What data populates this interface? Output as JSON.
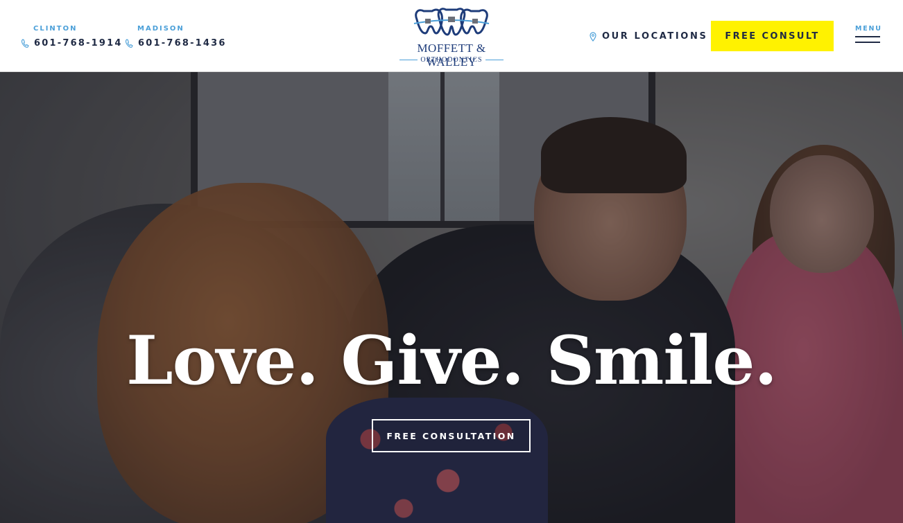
{
  "header": {
    "phones": [
      {
        "city": "CLINTON",
        "number": "601-768-1914"
      },
      {
        "city": "MADISON",
        "number": "601-768-1436"
      }
    ],
    "logo": {
      "name": "MOFFETT & WALLEY",
      "subtitle": "ORTHODONTICS"
    },
    "locations_label": "OUR LOCATIONS",
    "consult_button": "FREE CONSULT",
    "menu_label": "MENU"
  },
  "hero": {
    "headline": "Love. Give. Smile.",
    "cta_button": "FREE CONSULTATION"
  },
  "colors": {
    "accent_blue": "#4a9fd8",
    "navy": "#1f2a44",
    "logo_navy": "#1e3c7a",
    "cta_yellow": "#fff200"
  },
  "icons": [
    "phone-icon",
    "map-pin-icon",
    "hamburger-menu-icon",
    "tooth-braces-logo"
  ]
}
